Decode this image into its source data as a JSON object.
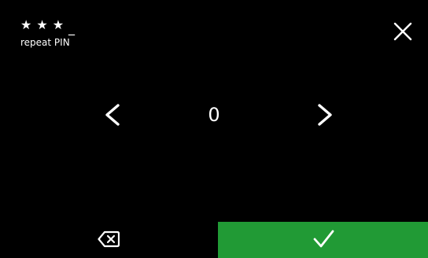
{
  "pin": {
    "entered_mask": "★★★",
    "cursor": "_",
    "label": "repeat PIN"
  },
  "selector": {
    "current_digit": "0"
  },
  "icons": {
    "close": "close-icon",
    "prev": "chevron-left-icon",
    "next": "chevron-right-icon",
    "backspace": "backspace-icon",
    "confirm": "checkmark-icon"
  },
  "colors": {
    "background": "#000000",
    "text": "#ffffff",
    "confirm": "#219a35"
  }
}
